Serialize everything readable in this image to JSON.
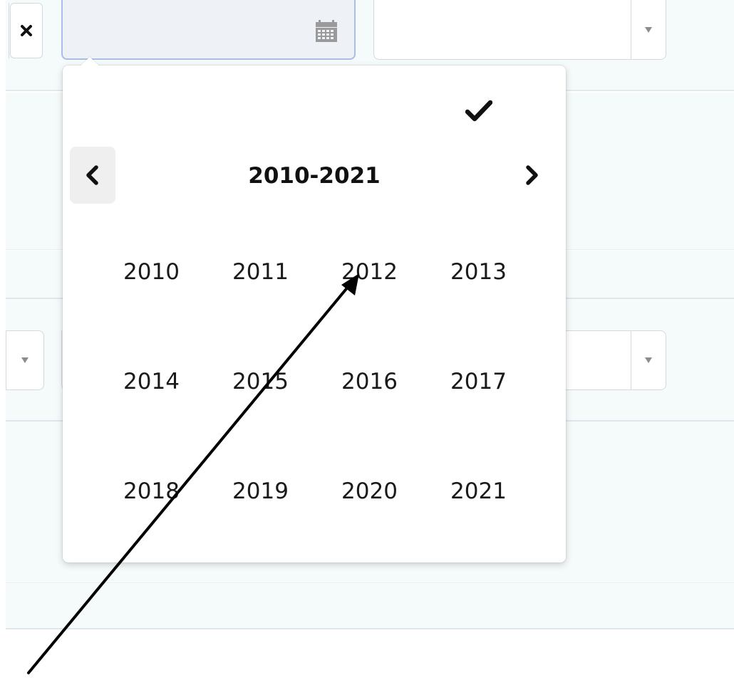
{
  "date_field": {
    "value": "",
    "placeholder": ""
  },
  "top_select": {
    "value": ""
  },
  "icons": {
    "clear": "close-x-icon",
    "calendar": "calendar-icon",
    "confirm": "checkmark-icon",
    "prev": "chevron-left-icon",
    "next": "chevron-right-icon",
    "dropdown": "caret-down-icon"
  },
  "year_picker": {
    "range_label": "2010-2021",
    "years": [
      "2010",
      "2011",
      "2012",
      "2013",
      "2014",
      "2015",
      "2016",
      "2017",
      "2018",
      "2019",
      "2020",
      "2021"
    ]
  },
  "colors": {
    "page_background": "#f5fbfb",
    "input_focus_border": "#a9bde6",
    "input_background": "#eef1f5",
    "text": "#1a1a1a"
  }
}
